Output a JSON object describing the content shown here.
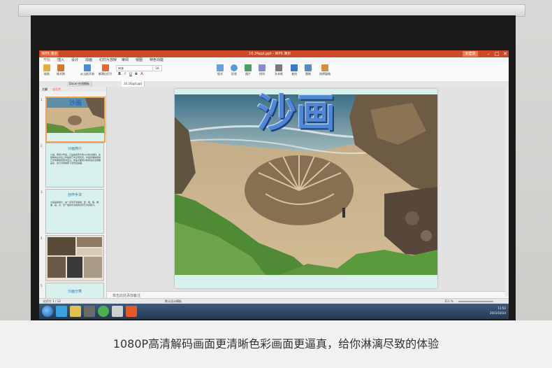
{
  "titlebar": {
    "app_tab": "WPS 演示",
    "window_title": "10.24ppt.ppt - WPS 演示",
    "login_label": "未登录",
    "controls": [
      "–",
      "□",
      "✕"
    ]
  },
  "menu": [
    "开始",
    "插入",
    "设计",
    "动画",
    "幻灯片放映",
    "审阅",
    "视图",
    "特色功能"
  ],
  "ribbon": {
    "font_name": "宋体",
    "font_size": "18",
    "buttons": [
      {
        "label": "粘贴",
        "icon": "paste-icon"
      },
      {
        "label": "格式刷",
        "icon": "format-painter-icon"
      },
      {
        "label": "从当前开始",
        "icon": "play-from-current-icon"
      },
      {
        "label": "新建幻灯片",
        "icon": "new-slide-icon"
      },
      {
        "label": "版式",
        "icon": "layout-icon"
      },
      {
        "label": "形状",
        "icon": "shape-icon"
      },
      {
        "label": "图片",
        "icon": "picture-icon"
      },
      {
        "label": "排列",
        "icon": "arrange-icon"
      },
      {
        "label": "文本框",
        "icon": "textbox-icon"
      },
      {
        "label": "查找",
        "icon": "find-icon"
      },
      {
        "label": "替换",
        "icon": "replace-icon"
      },
      {
        "label": "选择窗格",
        "icon": "selection-pane-icon"
      }
    ],
    "format_buttons": [
      "B",
      "I",
      "U",
      "S",
      "A"
    ]
  },
  "doc_tabs": [
    "Docer-在线模板",
    "10.24ppt.ppt"
  ],
  "left_pane": {
    "tabs": [
      "大纲",
      "幻灯片"
    ],
    "slides": [
      {
        "num": "1",
        "title": "沙画"
      },
      {
        "num": "2",
        "title": "沙画简介",
        "text": "沙画，即用沙作画，它是由用手代笔以沙粒为颜料，在特制的白光台上作画的艺术表现形式。作品有着独特的艺术效果和视觉冲击力。作品大都用沙粒将色彩全部覆盖住，在灯光的映照下显现出画面。"
      },
      {
        "num": "3",
        "title": "创作手法",
        "text": "沙画是指用沙，由一系列手法组成：抓、捏、搓、撒、漏、画、点、划一组的手法组成具有艺术感染力。"
      },
      {
        "num": "4",
        "title": ""
      },
      {
        "num": "5",
        "title": "沙画分类"
      }
    ]
  },
  "slide": {
    "title": "沙画"
  },
  "notes_placeholder": "单击此处添加备注",
  "statusbar": {
    "slide_counter": "幻灯片 1 / 12",
    "theme": "默认设计模板",
    "zoom": "111 %"
  },
  "taskbar": {
    "time": "11:52",
    "date": "2015/10/24"
  },
  "caption": "1080P高清解码画面更清晰色彩画面更逼真，给你淋漓尽致的体验",
  "colors": {
    "titlebar": "#cc4a2a",
    "slide_bg": "#d9f1ec",
    "title_blue": "#4f86d6"
  }
}
